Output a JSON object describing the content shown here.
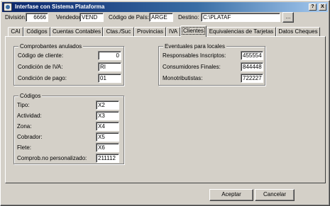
{
  "window": {
    "title": "Interfase con Sistema Plataforma",
    "controls": {
      "help": "?",
      "close": "X"
    }
  },
  "header": {
    "division_label": "División:",
    "division_value": "6666",
    "vendedor_label": "Vendedor",
    "vendedor_value": "VEND",
    "codigo_pais_label": "Código de País:",
    "codigo_pais_value": "ARGE",
    "destino_label": "Destino:",
    "destino_value": "C:\\PLATAF",
    "browse_label": "..."
  },
  "tabs": [
    {
      "label": "CAI"
    },
    {
      "label": "Códigos"
    },
    {
      "label": "Cuentas Contables"
    },
    {
      "label": "Ctas./Suc"
    },
    {
      "label": "Provincias"
    },
    {
      "label": "IVA"
    },
    {
      "label": "Clientes"
    },
    {
      "label": "Equivalencias de Tarjetas"
    },
    {
      "label": "Datos Cheques"
    }
  ],
  "tab_scroll": {
    "left": "◀",
    "right": "▶"
  },
  "comprobantes_anulados": {
    "title": "Comprobantes anulados",
    "rows": [
      {
        "label": "Código de cliente:",
        "value": "0"
      },
      {
        "label": "Condición de IVA:",
        "value": "RI"
      },
      {
        "label": "Condición de pago:",
        "value": "01"
      }
    ]
  },
  "eventuales": {
    "title": "Eventuales para locales",
    "rows": [
      {
        "label": "Responsables Inscriptos:",
        "value": "455554"
      },
      {
        "label": "Consumidores Finales:",
        "value": "844448"
      },
      {
        "label": "Monotributistas:",
        "value": "722227"
      }
    ]
  },
  "codigos": {
    "title": "Códigos",
    "rows": [
      {
        "label": "Tipo:",
        "value": "X2"
      },
      {
        "label": "Actividad:",
        "value": "X3"
      },
      {
        "label": "Zona:",
        "value": "X4"
      },
      {
        "label": "Cobrador:",
        "value": "X5"
      },
      {
        "label": "Flete:",
        "value": "X6"
      },
      {
        "label": "Comprob.no personalizado:",
        "value": "211112"
      }
    ]
  },
  "footer": {
    "accept_label": "Aceptar",
    "cancel_label": "Cancelar"
  }
}
